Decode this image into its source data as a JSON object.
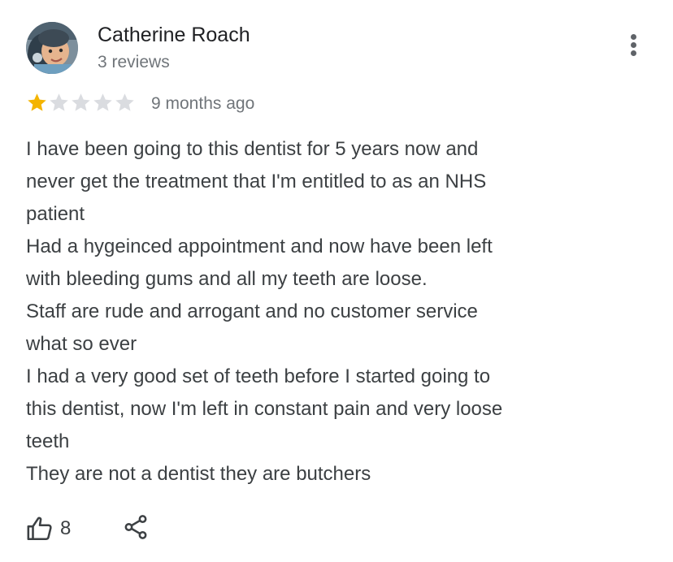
{
  "review": {
    "author": {
      "name": "Catherine Roach",
      "review_count": "3 reviews",
      "avatar_icon": "user-photo"
    },
    "rating": {
      "value": 1,
      "max": 5,
      "filled_color": "#f4b400",
      "empty_color": "#dadce0"
    },
    "date": "9 months ago",
    "text_lines": [
      "I have been going to this dentist for 5 years now and",
      "never get the treatment that I'm entitled to as an NHS",
      "patient",
      "Had a hygeinced appointment and now have been left",
      "with bleeding gums and all my teeth are loose.",
      "Staff are rude and arrogant and no customer service",
      "what so ever",
      "I had a very good set of teeth before I started going to",
      "this dentist, now I'm left in constant pain and very loose",
      "teeth",
      "They are not a dentist they are butchers"
    ],
    "likes": "8",
    "icons": {
      "more": "more-vert-icon",
      "like": "thumbs-up-icon",
      "share": "share-icon"
    }
  }
}
